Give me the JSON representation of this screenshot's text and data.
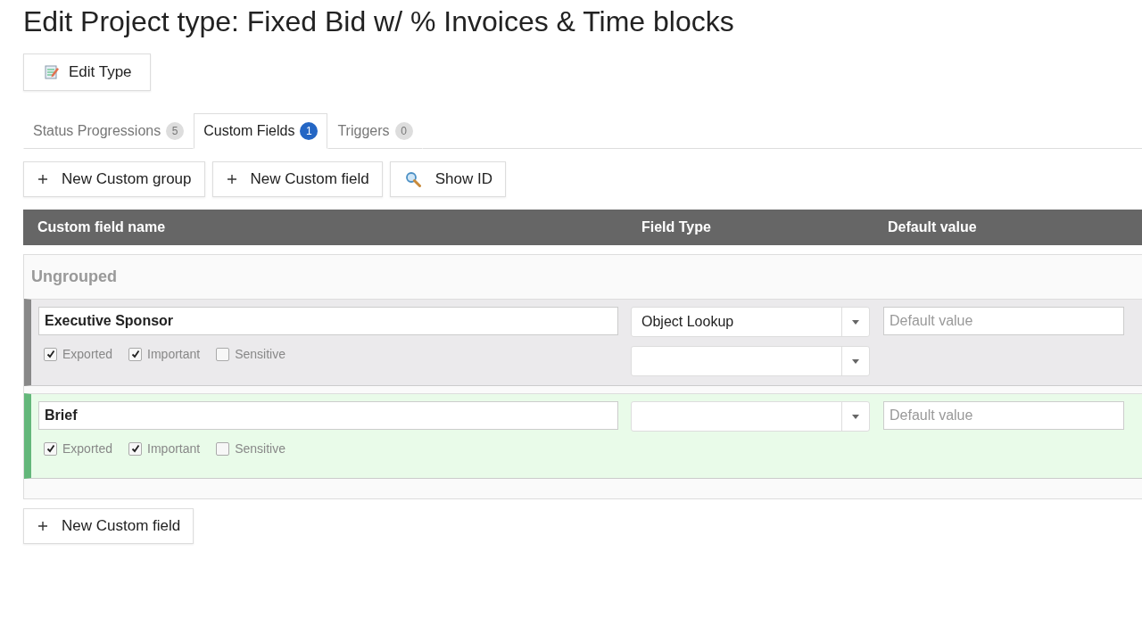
{
  "title": "Edit Project type: Fixed Bid w/ % Invoices & Time blocks",
  "edit_button": "Edit Type",
  "tabs": [
    {
      "label": "Status Progressions",
      "count": "5",
      "selected": false
    },
    {
      "label": "Custom Fields",
      "count": "1",
      "selected": true
    },
    {
      "label": "Triggers",
      "count": "0",
      "selected": false
    }
  ],
  "toolbar": [
    {
      "kind": "plus",
      "label": "New Custom group"
    },
    {
      "kind": "plus",
      "label": "New Custom field"
    },
    {
      "kind": "search",
      "label": "Show ID"
    }
  ],
  "table": {
    "columns": [
      "Custom field name",
      "Field Type",
      "Default value"
    ],
    "group": "Ungrouped",
    "rows": [
      {
        "name": "Executive Sponsor",
        "field_type": "Object Lookup",
        "default_placeholder": "Default value",
        "secondary_select": true,
        "highlighted": false,
        "flags": [
          {
            "label": "Exported",
            "checked": true
          },
          {
            "label": "Important",
            "checked": true
          },
          {
            "label": "Sensitive",
            "checked": false
          }
        ]
      },
      {
        "name": "Brief",
        "default_placeholder": "Default value",
        "secondary_select": false,
        "highlighted": true,
        "flags": [
          {
            "label": "Exported",
            "checked": true
          },
          {
            "label": "Important",
            "checked": true
          },
          {
            "label": "Sensitive",
            "checked": false
          }
        ]
      }
    ]
  },
  "footer_button": "New Custom field"
}
